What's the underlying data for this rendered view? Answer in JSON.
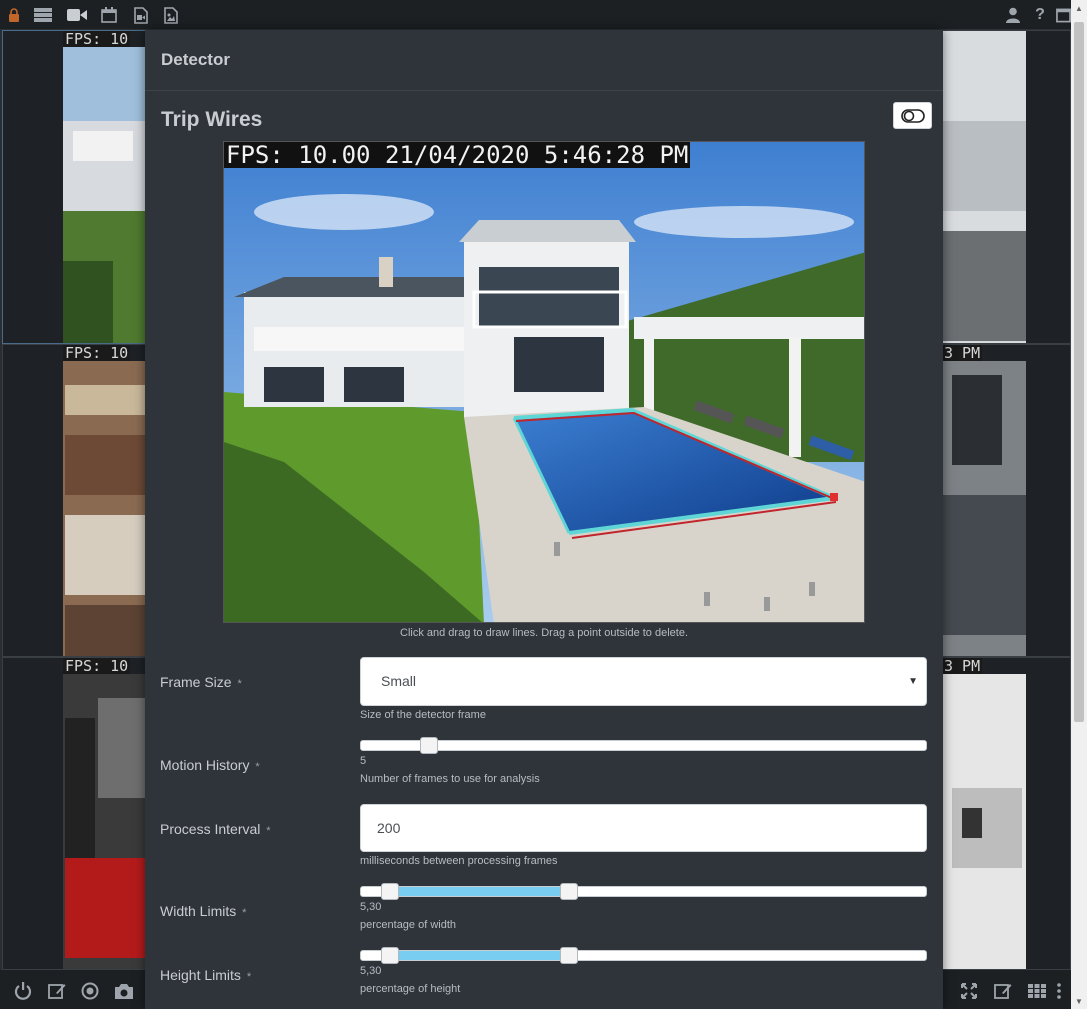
{
  "toolbar": {
    "icons": [
      "lock-icon",
      "server-list-icon",
      "video-camera-icon",
      "calendar-icon",
      "video-file-icon",
      "image-file-icon"
    ],
    "right_icons": [
      "user-icon",
      "help-icon",
      "window-icon"
    ],
    "help_glyph": "?"
  },
  "grid": {
    "fps_label": "FPS: 10",
    "pm_label": "3 PM"
  },
  "dialog": {
    "title": "Detector",
    "section_title": "Trip Wires",
    "preview": {
      "overlay_text": "FPS: 10.00 21/04/2020 5:46:28 PM",
      "hint": "Click and drag to draw lines. Drag a point outside to delete."
    },
    "frame_size": {
      "label": "Frame Size",
      "required_mark": "*",
      "value": "Small",
      "help": "Size of the detector frame"
    },
    "motion_history": {
      "label": "Motion History",
      "required_mark": "*",
      "value": 5,
      "min": 1,
      "max": 100,
      "value_text": "5",
      "help": "Number of frames to use for analysis"
    },
    "process_interval": {
      "label": "Process Interval",
      "required_mark": "*",
      "value": "200",
      "help": "milliseconds between processing frames"
    },
    "width_limits": {
      "label": "Width Limits",
      "required_mark": "*",
      "low": 5,
      "high": 30,
      "value_text": "5,30",
      "help": "percentage of width"
    },
    "height_limits": {
      "label": "Height Limits",
      "required_mark": "*",
      "low": 5,
      "high": 30,
      "value_text": "5,30",
      "help": "percentage of height"
    }
  },
  "bottombar": {
    "left_icons": [
      "power-icon",
      "edit-icon",
      "record-icon",
      "camera-icon"
    ],
    "right_icons": [
      "fullscreen-icon",
      "edit-icon",
      "grid-icon",
      "more-icon"
    ]
  },
  "colors": {
    "tripwire_red": "#c0262c",
    "tripwire_cyan": "#5fd6d6",
    "slider_fill": "#79cdf0"
  }
}
